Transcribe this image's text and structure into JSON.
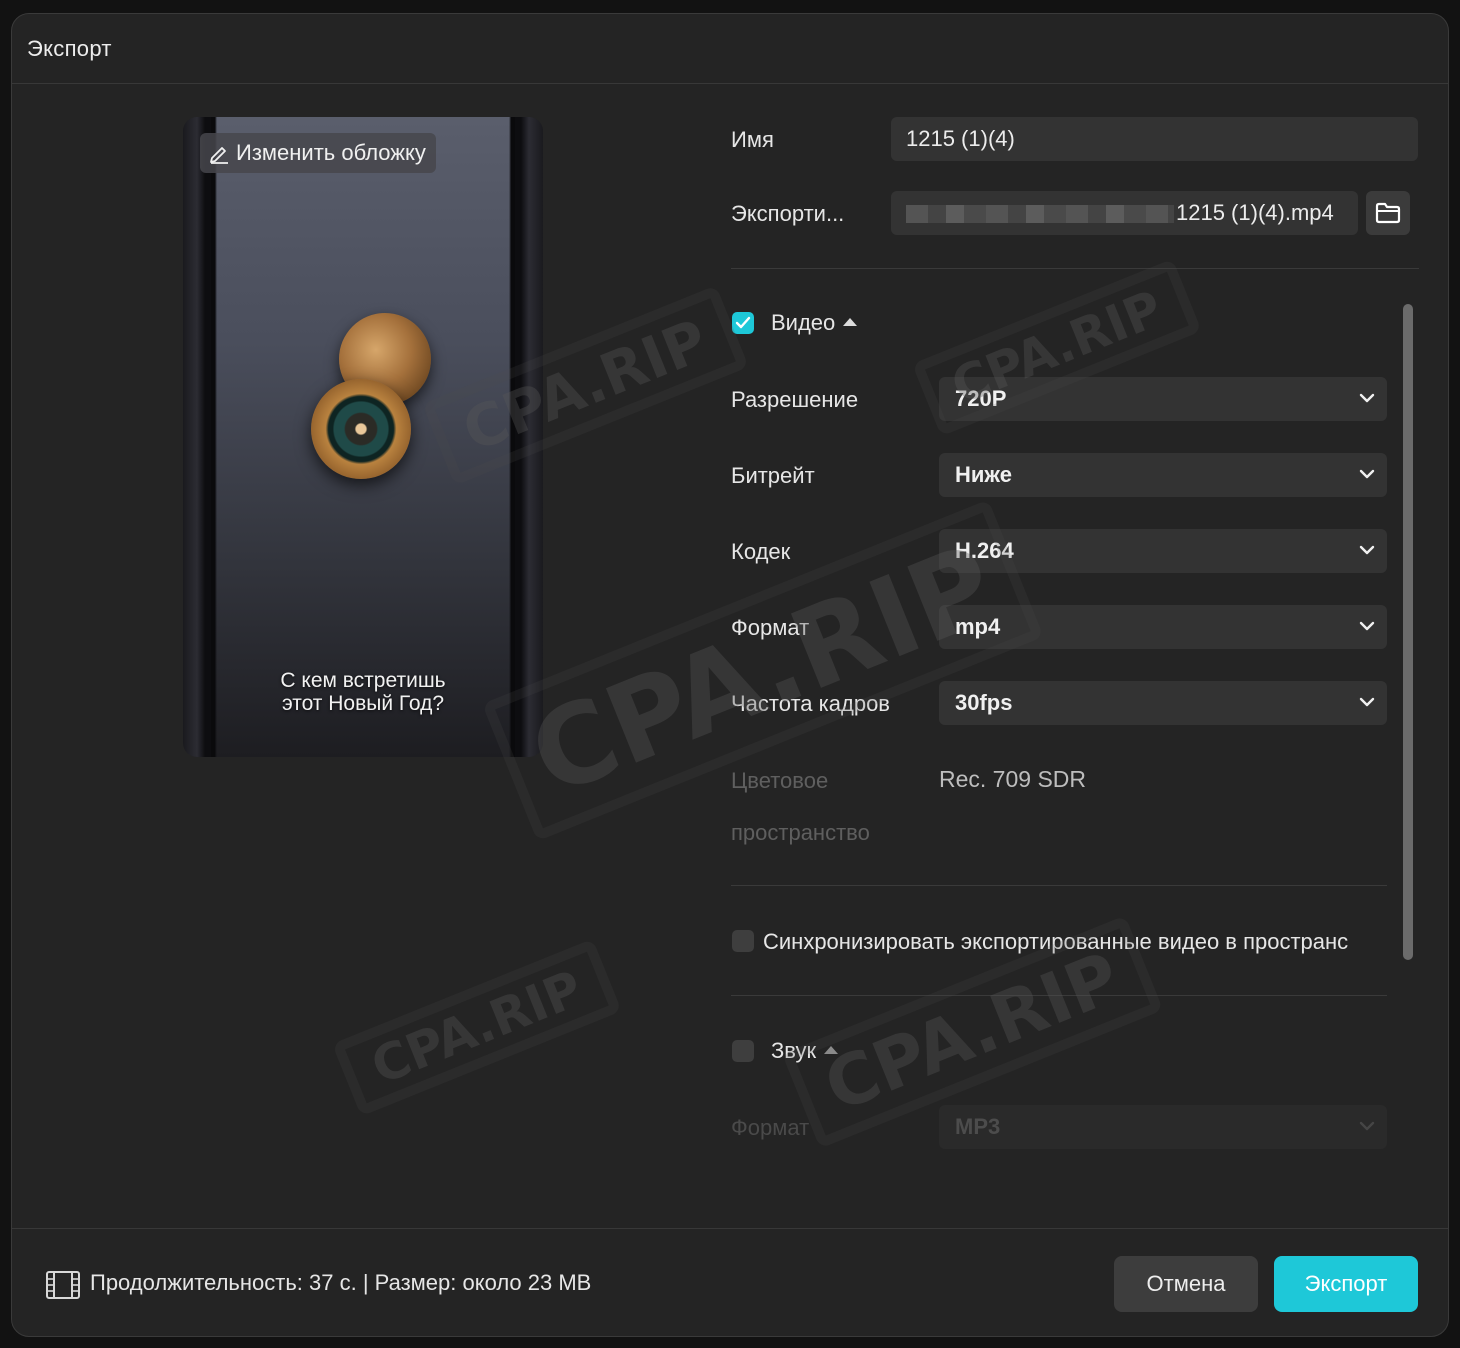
{
  "dialog": {
    "title": "Экспорт"
  },
  "preview": {
    "change_cover_label": "Изменить обложку",
    "caption_line1": "С кем встретишь",
    "caption_line2": "этот Новый Год?"
  },
  "form": {
    "name_label": "Имя",
    "name_value": "1215 (1)(4)",
    "export_path_label": "Экспорти...",
    "export_path_value": "1215 (1)(4).mp4"
  },
  "video": {
    "section_label": "Видео",
    "enabled": true,
    "resolution_label": "Разрешение",
    "resolution_value": "720P",
    "bitrate_label": "Битрейт",
    "bitrate_value": "Ниже",
    "codec_label": "Кодек",
    "codec_value": "H.264",
    "format_label": "Формат",
    "format_value": "mp4",
    "framerate_label": "Частота кадров",
    "framerate_value": "30fps",
    "colorspace_label_line1": "Цветовое",
    "colorspace_label_line2": "пространство",
    "colorspace_value": "Rec. 709 SDR"
  },
  "sync": {
    "label": "Синхронизировать экспортированные видео в пространс",
    "enabled": false
  },
  "audio": {
    "section_label": "Звук",
    "enabled": false,
    "format_label": "Формат",
    "format_value": "MP3"
  },
  "footer": {
    "info": "Продолжительность: 37 с. | Размер: около 23 MB",
    "cancel_label": "Отмена",
    "export_label": "Экспорт"
  },
  "watermark": {
    "text": "CPA.RIP"
  },
  "colors": {
    "accent": "#1ec8d8",
    "background": "#242424",
    "field": "#333333"
  }
}
